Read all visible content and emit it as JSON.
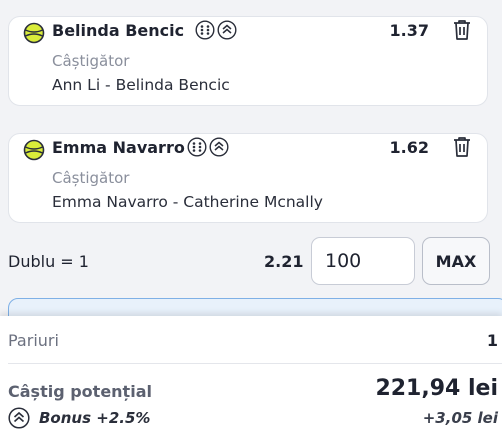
{
  "selections": [
    {
      "player": "Belinda Bencic",
      "odds": "1.37",
      "market": "Câștigător",
      "event": "Ann Li - Belinda Bencic",
      "icons": [
        "tennis-ball-icon",
        "live-stats-icon",
        "boost-icon",
        "delete-icon"
      ]
    },
    {
      "player": "Emma Navarro",
      "odds": "1.62",
      "market": "Câștigător",
      "event": "Emma Navarro - Catherine Mcnally",
      "icons": [
        "tennis-ball-icon",
        "live-stats-icon",
        "boost-icon",
        "delete-icon"
      ]
    }
  ],
  "combo": {
    "label": "Dublu = 1",
    "odds": "2.21",
    "stake_value": "100",
    "max_label": "MAX"
  },
  "summary": {
    "bets_label": "Pariuri",
    "bets_count": "1",
    "potential_win_label": "Câștig potențial",
    "potential_win_value": "221,94 lei",
    "bonus_label": "Bonus +2.5%",
    "bonus_value": "+3,05 lei"
  },
  "colors": {
    "tennis_ball": "#d9ec3a",
    "info_banner_border": "#7fb0e6",
    "info_banner_bg": "#e8f1fb"
  }
}
